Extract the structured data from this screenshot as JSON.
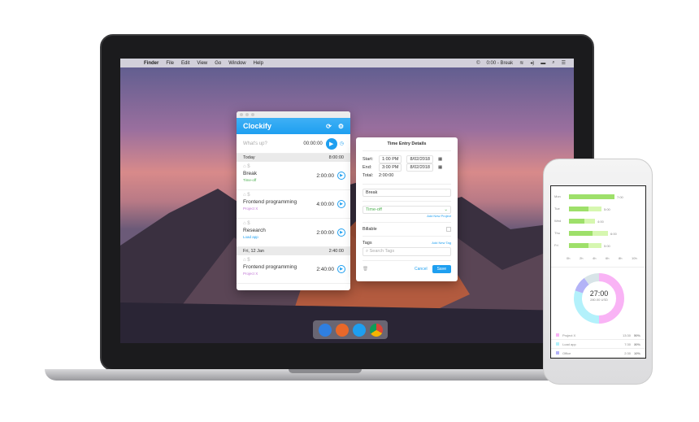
{
  "menubar": {
    "apple": "",
    "items": [
      "Finder",
      "File",
      "Edit",
      "View",
      "Go",
      "Window",
      "Help"
    ],
    "status": "0:00 - Break"
  },
  "app": {
    "title": "Clockify",
    "placeholder": "What's up?",
    "timer": "00:00:00",
    "groups": [
      {
        "label": "Today",
        "total": "8:00:00",
        "entries": [
          {
            "desc": "Break",
            "project": "Time-off",
            "color": "#4caf50",
            "duration": "2:00:00"
          },
          {
            "desc": "Frontend programming",
            "project": "Project X",
            "color": "#c27ad6",
            "duration": "4:00:00"
          },
          {
            "desc": "Research",
            "project": "Load app",
            "color": "#1e9ff0",
            "duration": "2:00:00"
          }
        ]
      },
      {
        "label": "Fri, 12 Jan",
        "total": "2:40:00",
        "entries": [
          {
            "desc": "Frontend programming",
            "project": "Project X",
            "color": "#c27ad6",
            "duration": "2:40:00"
          }
        ]
      }
    ]
  },
  "details": {
    "title": "Time Entry Details",
    "start_label": "Start:",
    "start_time": "1:00 PM",
    "start_date": "8/02/2018",
    "end_label": "End:",
    "end_time": "3:00 PM",
    "end_date": "8/02/2018",
    "total_label": "Total:",
    "total": "2:00:00",
    "description": "Break",
    "project": "Time-off",
    "add_project": "Add New Project",
    "billable": "Billable",
    "tags": "Tags",
    "add_tag": "Add New Tag",
    "search_tags": "Search Tags",
    "cancel": "Cancel",
    "save": "Save"
  },
  "phone": {
    "chart_data": {
      "type": "bar",
      "categories": [
        "Mon",
        "Tue",
        "Wed",
        "Thu",
        "Fri"
      ],
      "values": [
        7,
        5,
        4,
        6,
        5
      ],
      "value_labels": [
        "7:00",
        "5:00",
        "4:00",
        "6:00",
        "5:00"
      ],
      "xticks": [
        "0h",
        "2h",
        "4h",
        "6h",
        "8h",
        "10h"
      ],
      "xlim": [
        0,
        10
      ]
    },
    "donut": {
      "total": "27:00",
      "amount": "280.00 USD",
      "slices": [
        {
          "name": "Project X",
          "time": "13:30",
          "pct": "50%",
          "value": 50,
          "color": "#f9b3f5"
        },
        {
          "name": "Load app",
          "time": "7:30",
          "pct": "30%",
          "value": 30,
          "color": "#b3f1fb"
        },
        {
          "name": "Office",
          "time": "2:30",
          "pct": "10%",
          "value": 10,
          "color": "#b3b3f7"
        },
        {
          "name": "",
          "value": 10,
          "color": "#d8e4e8"
        }
      ]
    }
  }
}
